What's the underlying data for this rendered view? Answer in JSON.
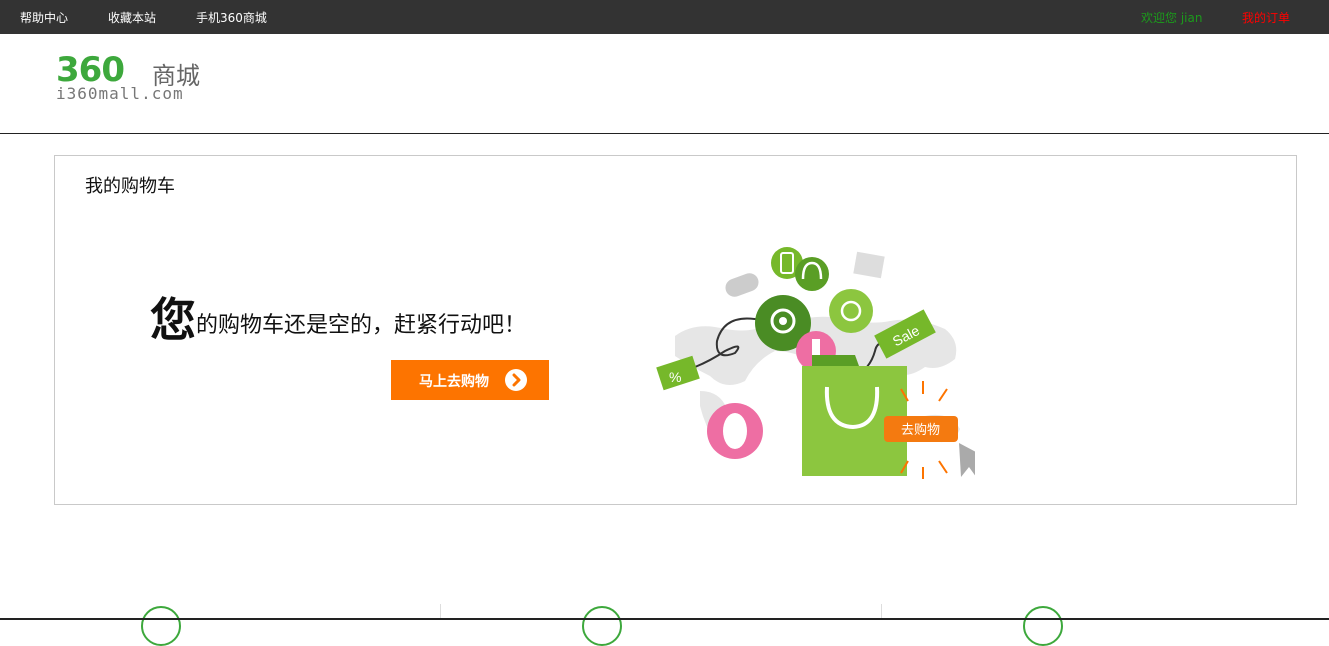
{
  "topbar": {
    "help_center": "帮助中心",
    "bookmark_site": "收藏本站",
    "mobile_mall": "手机360商城",
    "welcome": "欢迎您 jian",
    "my_orders": "我的订单"
  },
  "logo": {
    "number": "360",
    "chinese": "商城",
    "domain": "i360mall.com"
  },
  "cart": {
    "title": "我的购物车",
    "empty_big_char": "您",
    "empty_rest": "的购物车还是空的，赶紧行动吧！",
    "shop_button": "马上去购物",
    "illustration_tag_sale": "Sale",
    "illustration_tag_percent": "%",
    "illustration_button": "去购物"
  },
  "colors": {
    "topbar_bg": "#333333",
    "welcome": "#1c9a1c",
    "orders": "#ff0000",
    "accent_orange": "#fd7400",
    "brand_green": "#3da83c"
  }
}
